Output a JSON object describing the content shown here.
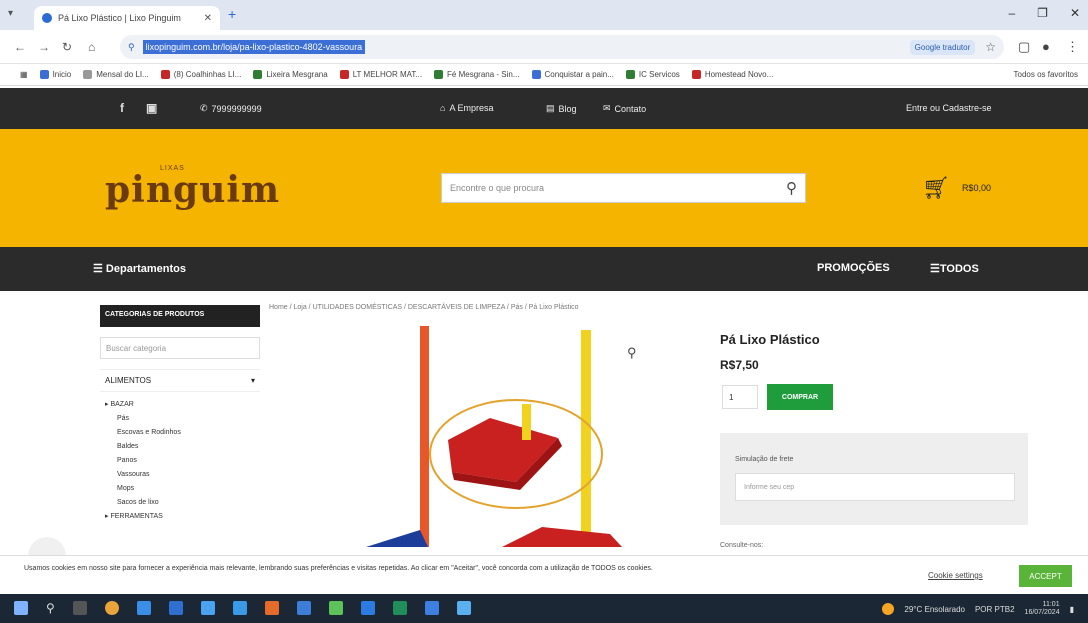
{
  "browser": {
    "tab_title": "Pá Lixo Plástico | Lixo Pinguim",
    "tab_close": "✕",
    "new_tab": "+",
    "url": "lixopinguim.com.br/loja/pa-lixo-plastico-4802-vassoura",
    "translate_label": "Google tradutor",
    "bookmarks": [
      {
        "label": "Inicio",
        "color": "#3b6fd6"
      },
      {
        "label": "Mensal do LI...",
        "color": "#999999"
      },
      {
        "label": "(8) Coalhinhas LI...",
        "color": "#c62828"
      },
      {
        "label": "Lixeira Mesgrana",
        "color": "#2e7d32"
      },
      {
        "label": "LT MELHOR MAT...",
        "color": "#c62828"
      },
      {
        "label": "Fé Mesgrana - Sin...",
        "color": "#2e7d32"
      },
      {
        "label": "Conquistar a pain...",
        "color": "#3b6fd6"
      },
      {
        "label": "IC Servicos",
        "color": "#2e7d32"
      },
      {
        "label": "Homestead Novo...",
        "color": "#c62828"
      }
    ],
    "bookmarks_more": "Todos os favoritos"
  },
  "topbar": {
    "social": [
      "f",
      "▣"
    ],
    "whatsapp": "7999999999",
    "empresa": "A Empresa",
    "blog": "Blog",
    "contato": "Contato",
    "login": "Entre ou Cadastre-se"
  },
  "header": {
    "logo_small": "LIXAS",
    "logo_big": "pinguim",
    "search_placeholder": "Encontre o que procura",
    "cart_price": "R$0,00"
  },
  "nav": {
    "departments": "Departamentos",
    "promocoes": "PROMOÇÕES",
    "todos": "TODOS"
  },
  "sidebar": {
    "heading": "CATEGORIAS DE PRODUTOS",
    "search_placeholder": "Buscar categoria",
    "group": "ALIMENTOS",
    "items": [
      {
        "label": "BAZAR",
        "sub": false
      },
      {
        "label": "Pás",
        "sub": true
      },
      {
        "label": "Escovas e Rodinhos",
        "sub": true
      },
      {
        "label": "Baldes",
        "sub": true
      },
      {
        "label": "Panos",
        "sub": true
      },
      {
        "label": "Vassouras",
        "sub": true
      },
      {
        "label": "Mops",
        "sub": true
      },
      {
        "label": "Sacos de lixo",
        "sub": true
      },
      {
        "label": "FERRAMENTAS",
        "sub": false
      }
    ]
  },
  "breadcrumb": "Home / Loja / UTILIDADES DOMÉSTICAS / DESCARTÁVEIS DE LIMPEZA / Pás / Pá Lixo Plástico",
  "product": {
    "title": "Pá Lixo Plástico",
    "price": "R$7,50",
    "qty": "1",
    "buy": "COMPRAR",
    "ship_label": "Simulação de frete",
    "ship_placeholder": "Informe seu cep",
    "below": "Consulte-nos: "
  },
  "cookie": {
    "text": "Usamos cookies em nosso site para fornecer a experiência mais relevante, lembrando suas preferências e visitas repetidas. Ao clicar em \"Aceitar\", você concorda com a utilização de TODOS os cookies.",
    "settings": "Cookie settings",
    "accept": "ACCEPT"
  },
  "taskbar": {
    "weather": "29°C Ensolarado",
    "time": "11:01",
    "date": "16/07/2024",
    "lang": "POR PTB2"
  }
}
